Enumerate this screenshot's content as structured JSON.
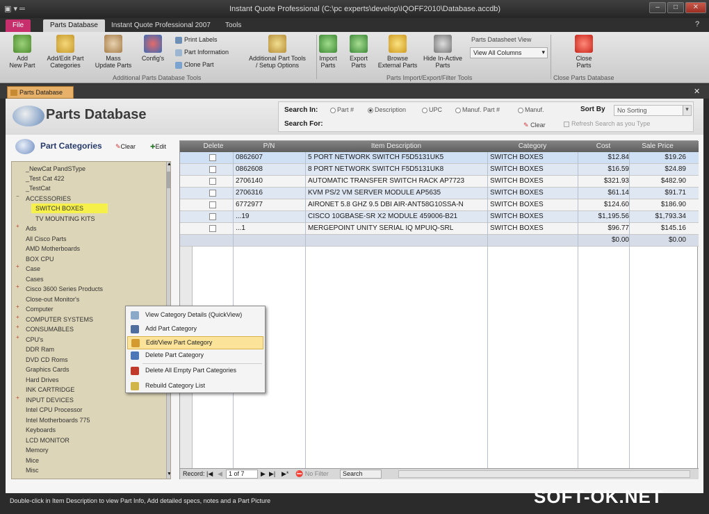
{
  "window": {
    "title": "Instant Quote Professional   (C:\\pc experts\\develop\\IQOFF2010\\Database.accdb)"
  },
  "tabs": [
    "File",
    "Parts Database",
    "Instant Quote Professional 2007",
    "Tools"
  ],
  "ribbon": {
    "add_new_part": "Add\nNew Part",
    "add_edit_categories": "Add/Edit Part\nCategories",
    "mass_update": "Mass\nUpdate Parts",
    "configs": "Config's",
    "print_labels": "Print Labels",
    "part_information": "Part Information",
    "clone_part": "Clone Part",
    "additional_tools": "Additional Part Tools\n/ Setup Options",
    "import_parts": "Import\nParts",
    "export_parts": "Export\nParts",
    "browse_external": "Browse\nExternal Parts",
    "hide_inactive": "Hide In-Active\nParts",
    "datasheet_view_label": "Parts Datasheet View",
    "datasheet_view_value": "View All Columns",
    "close_parts": "Close\nParts",
    "group_additional": "Additional Parts Database Tools",
    "group_import": "Parts Import/Export/Filter Tools",
    "group_close": "Close Parts Database"
  },
  "doc_tab": "Parts Database",
  "header": {
    "title": "Parts Database"
  },
  "search": {
    "search_in_label": "Search In:",
    "options": [
      "Part #",
      "Description",
      "UPC",
      "Manuf. Part #",
      "Manuf."
    ],
    "search_for_label": "Search For:",
    "sort_by_label": "Sort By",
    "sort_value": "No Sorting",
    "clear": "Clear",
    "refresh_label": "Refresh Search as you Type"
  },
  "categories": {
    "title": "Part Categories",
    "clear": "Clear",
    "edit": "Edit",
    "items": [
      "_NewCat PandSType",
      "_Test Cat 422",
      "_TestCat",
      "ACCESSORIES",
      "SWITCH BOXES",
      "TV MOUNTING KITS",
      "Ads",
      "All Cisco Parts",
      "AMD Motherboards",
      "BOX CPU",
      "Case",
      "Cases",
      "Cisco 3600 Series Products",
      "Close-out Monitor's",
      "Computer",
      "COMPUTER SYSTEMS",
      "CONSUMABLES",
      "CPU's",
      "DDR Ram",
      "DVD CD Roms",
      "Graphics Cards",
      "Hard Drives",
      "INK CARTRIDGE",
      "INPUT DEVICES",
      "Intel CPU Processor",
      "Intel Motherboards 775",
      "Keyboards",
      "LCD MONITOR",
      "Memory",
      "Mice",
      "Misc"
    ]
  },
  "grid": {
    "columns": [
      "Delete",
      "P/N",
      "Item Description",
      "Category",
      "Cost",
      "Sale Price"
    ],
    "rows": [
      [
        "0862607",
        "5 PORT NETWORK SWITCH F5D5131UK5",
        "SWITCH BOXES",
        "$12.84",
        "$19.26"
      ],
      [
        "0862608",
        "8 PORT NETWORK SWITCH F5D5131UK8",
        "SWITCH BOXES",
        "$16.59",
        "$24.89"
      ],
      [
        "2706140",
        "AUTOMATIC TRANSFER SWITCH RACK AP7723",
        "SWITCH BOXES",
        "$321.93",
        "$482.90"
      ],
      [
        "2706316",
        "KVM PS/2 VM SERVER MODULE AP5635",
        "SWITCH BOXES",
        "$61.14",
        "$91.71"
      ],
      [
        "6772977",
        "AIRONET 5.8 GHZ 9.5 DBI AIR-ANT58G10SSA-N",
        "SWITCH BOXES",
        "$124.60",
        "$186.90"
      ],
      [
        "...19",
        "CISCO 10GBASE-SR X2 MODULE 459006-B21",
        "SWITCH BOXES",
        "$1,195.56",
        "$1,793.34"
      ],
      [
        "...1",
        "MERGEPOINT UNITY SERIAL IQ MPUIQ-SRL",
        "SWITCH BOXES",
        "$96.77",
        "$145.16"
      ],
      [
        "",
        "",
        "",
        "$0.00",
        "$0.00"
      ]
    ],
    "record_label": "Record:",
    "record_value": "1 of 7",
    "no_filter": "No Filter",
    "search": "Search"
  },
  "context_menu": [
    "View Category Details (QuickView)",
    "Add Part Category",
    "Edit/View Part Category",
    "Delete Part Category",
    "Delete All Empty Part Categories",
    "Rebuild Category List"
  ],
  "status_text": "Double-click in Item Description to view Part Info, Add detailed specs, notes and a Part Picture",
  "watermark": "SOFT-OK.NET"
}
